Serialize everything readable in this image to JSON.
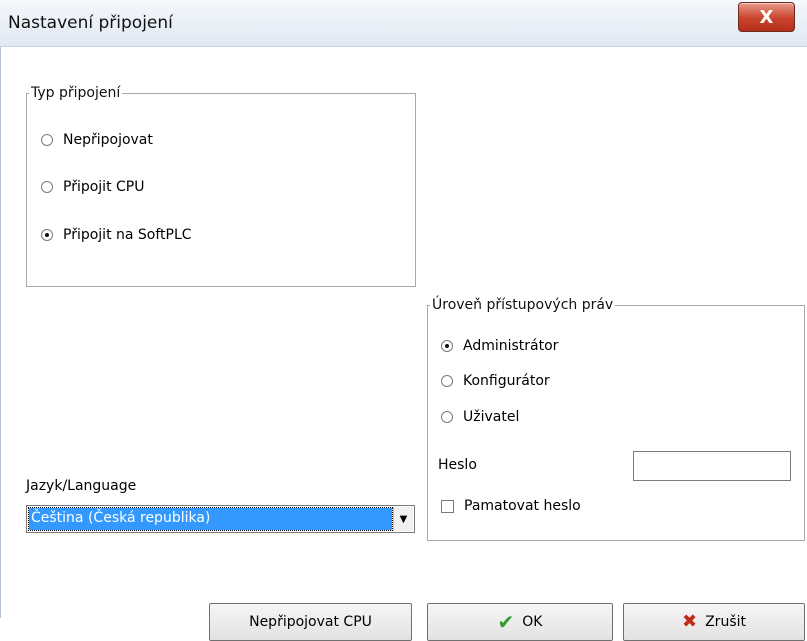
{
  "window": {
    "title": "Nastavení připojení",
    "close_label": "X"
  },
  "connection_type": {
    "legend": "Typ připojení",
    "options": [
      {
        "label": "Nepřipojovat",
        "selected": false
      },
      {
        "label": "Připojit CPU",
        "selected": false
      },
      {
        "label": "Připojit na SoftPLC",
        "selected": true
      }
    ]
  },
  "access_level": {
    "legend": "Úroveň přístupových práv",
    "options": [
      {
        "label": "Administrátor",
        "selected": true
      },
      {
        "label": "Konfigurátor",
        "selected": false
      },
      {
        "label": "Uživatel",
        "selected": false
      }
    ],
    "password_label": "Heslo",
    "password_value": "",
    "remember_label": "Pamatovat heslo",
    "remember_checked": false
  },
  "language": {
    "label": "Jazyk/Language",
    "selected": "Čeština (Česká republika)"
  },
  "buttons": {
    "disconnect_cpu": "Nepřipojovat CPU",
    "ok": "OK",
    "cancel": "Zrušit"
  },
  "icons": {
    "ok_icon": "check-icon",
    "cancel_icon": "x-icon",
    "ok_color": "#2f9a2f",
    "cancel_color": "#c02a1c",
    "close_color": "#c9442c"
  }
}
